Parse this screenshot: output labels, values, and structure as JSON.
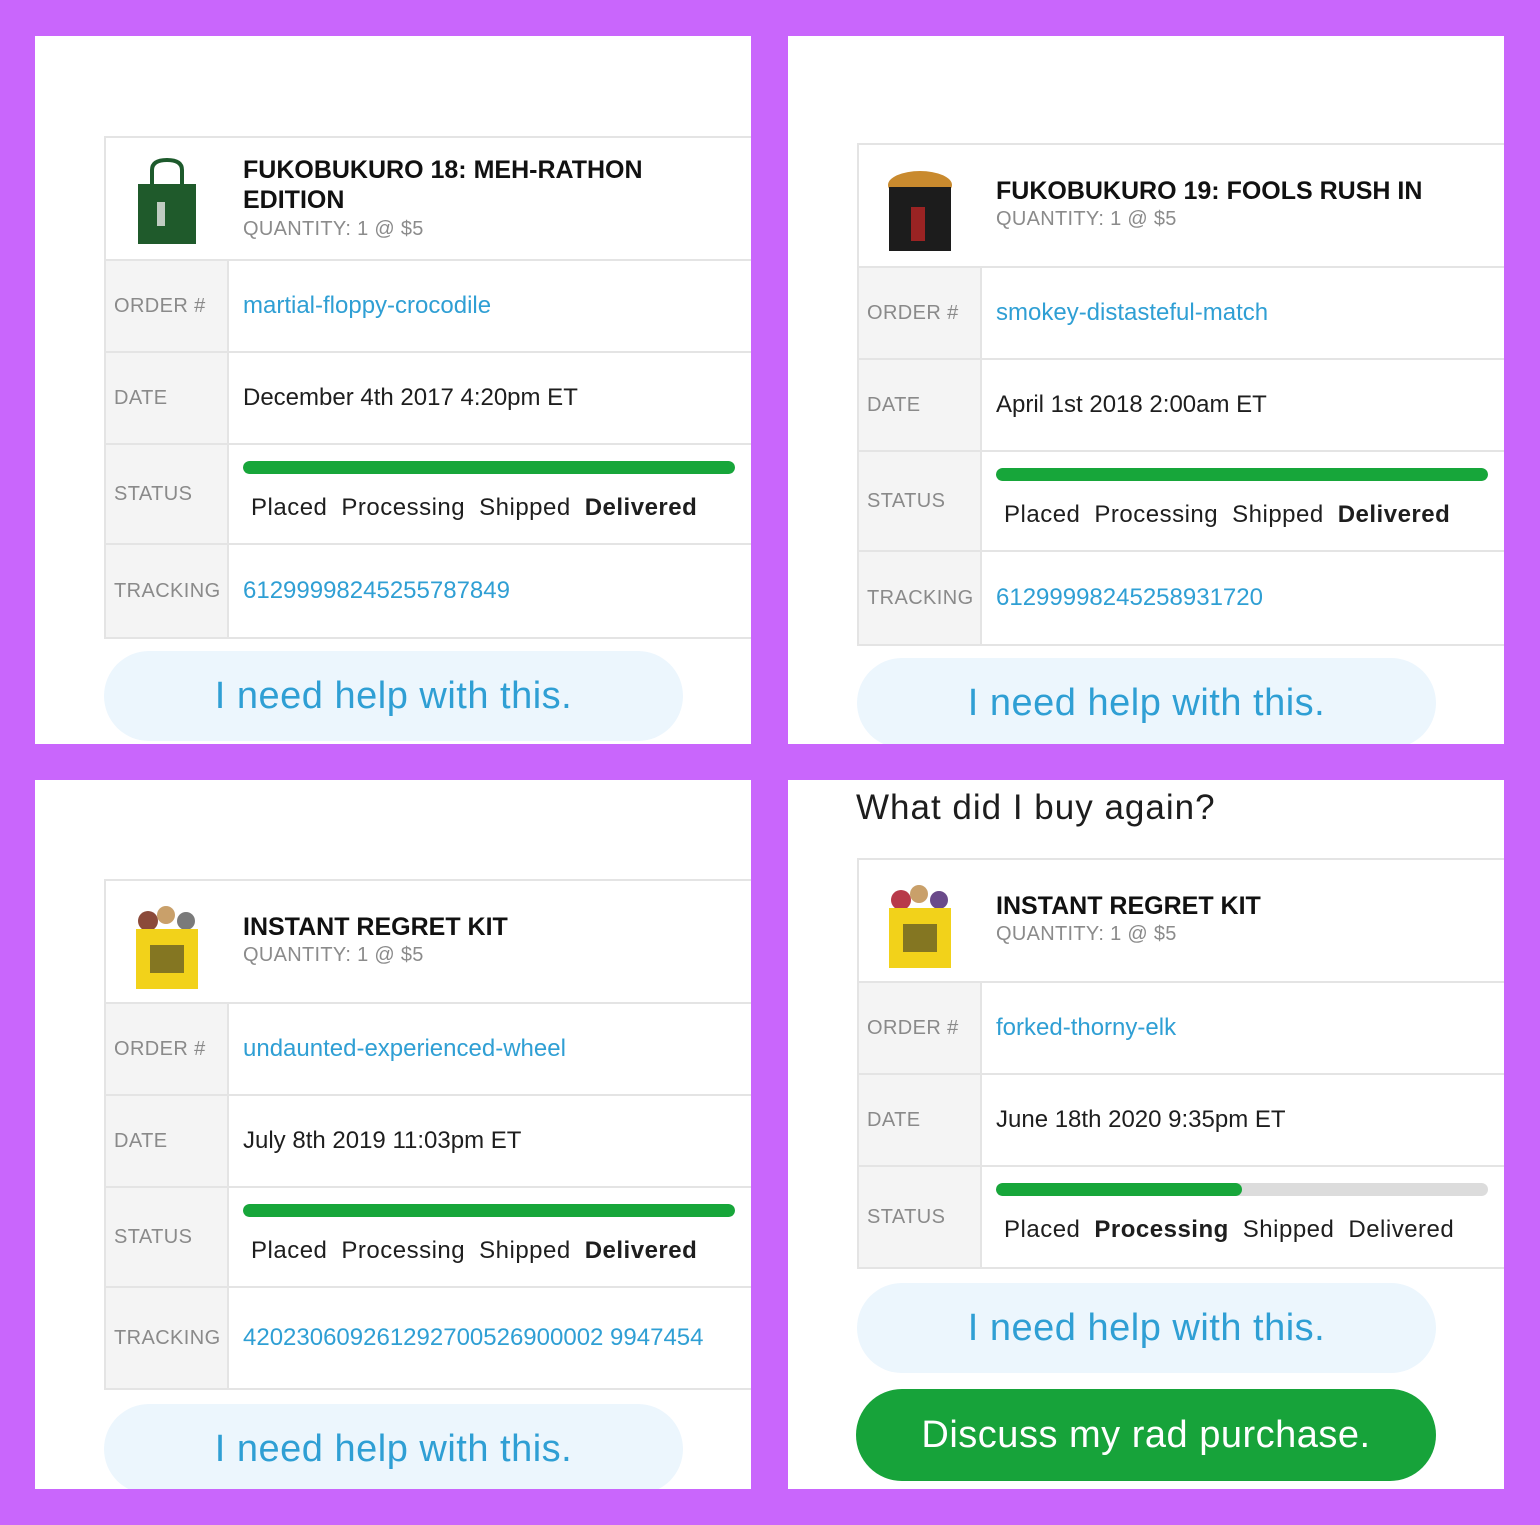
{
  "colors": {
    "background": "#c966fc",
    "link": "#2f9fd4",
    "progress_fill": "#17a63a",
    "progress_track": "#dcdcdc",
    "help_button_bg": "#ecf6fd",
    "discuss_button_bg": "#17a33a"
  },
  "labels": {
    "order": "ORDER #",
    "date": "DATE",
    "status": "STATUS",
    "tracking": "TRACKING"
  },
  "steps": [
    "Placed",
    "Processing",
    "Shipped",
    "Delivered"
  ],
  "panels": [
    {
      "product": {
        "title": "FUKOBUKURO 18: MEH-RATHON EDITION",
        "quantity": "QUANTITY: 1 @ $5",
        "icon": "green-tote-bag-icon"
      },
      "order_number": "martial-floppy-crocodile",
      "date": "December 4th 2017 4:20pm ET",
      "status_step": "Delivered",
      "progress": 1.0,
      "tracking": "61299998245255787849",
      "help_label": "I need help with this."
    },
    {
      "product": {
        "title": "FUKOBUKURO 19: FOOLS RUSH IN",
        "quantity": "QUANTITY: 1 @ $5",
        "icon": "black-tote-bag-icon"
      },
      "order_number": "smokey-distasteful-match",
      "date": "April 1st 2018 2:00am ET",
      "status_step": "Delivered",
      "progress": 1.0,
      "tracking": "61299998245258931720",
      "help_label": "I need help with this."
    },
    {
      "product": {
        "title": "INSTANT REGRET KIT",
        "quantity": "QUANTITY: 1 @ $5",
        "icon": "yellow-tote-bag-icon"
      },
      "order_number": "undaunted-experienced-wheel",
      "date": "July 8th 2019 11:03pm ET",
      "status_step": "Delivered",
      "progress": 1.0,
      "tracking": "420230609261292700526900002 9947454",
      "help_label": "I need help with this."
    },
    {
      "heading": "What did I buy again?",
      "product": {
        "title": "INSTANT REGRET KIT",
        "quantity": "QUANTITY: 1 @ $5",
        "icon": "yellow-tote-bag-icon"
      },
      "order_number": "forked-thorny-elk",
      "date": "June 18th 2020 9:35pm ET",
      "status_step": "Processing",
      "progress": 0.5,
      "help_label": "I need help with this.",
      "discuss_label": "Discuss my rad purchase."
    }
  ]
}
